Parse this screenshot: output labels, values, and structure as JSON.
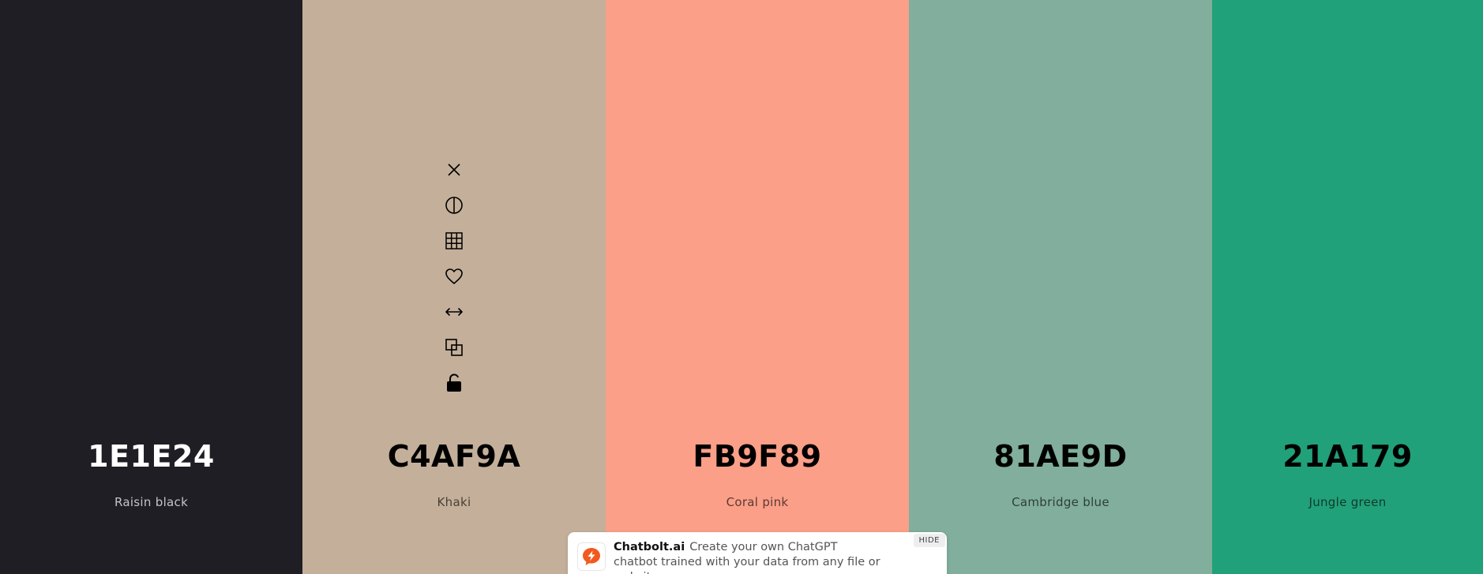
{
  "palette": {
    "colors": [
      {
        "hex": "1E1E24",
        "name": "Raisin black",
        "bg": "#1E1E24",
        "text_color": "#ffffff",
        "name_color": "#c4c4c8"
      },
      {
        "hex": "C4AF9A",
        "name": "Khaki",
        "bg": "#C4AF9A",
        "text_color": "#000000",
        "name_color": "#4a4036"
      },
      {
        "hex": "FB9F89",
        "name": "Coral pink",
        "bg": "#FB9F89",
        "text_color": "#000000",
        "name_color": "#5a3a32"
      },
      {
        "hex": "81AE9D",
        "name": "Cambridge blue",
        "bg": "#81AE9D",
        "text_color": "#000000",
        "name_color": "#2f3f39"
      },
      {
        "hex": "21A179",
        "name": "Jungle green",
        "bg": "#21A179",
        "text_color": "#000000",
        "name_color": "#0f3a2c"
      }
    ],
    "hovered_index": 1,
    "tool_icons": [
      "close-icon",
      "contrast-icon",
      "grid-shades-icon",
      "heart-icon",
      "drag-arrows-icon",
      "copy-icon",
      "lock-open-icon"
    ]
  },
  "chatbot": {
    "brand": "Chatbolt.ai",
    "message": "Create your own ChatGPT chatbot trained with your data from any file or website.",
    "hide_label": "HIDE",
    "accent": "#f25a1d"
  }
}
